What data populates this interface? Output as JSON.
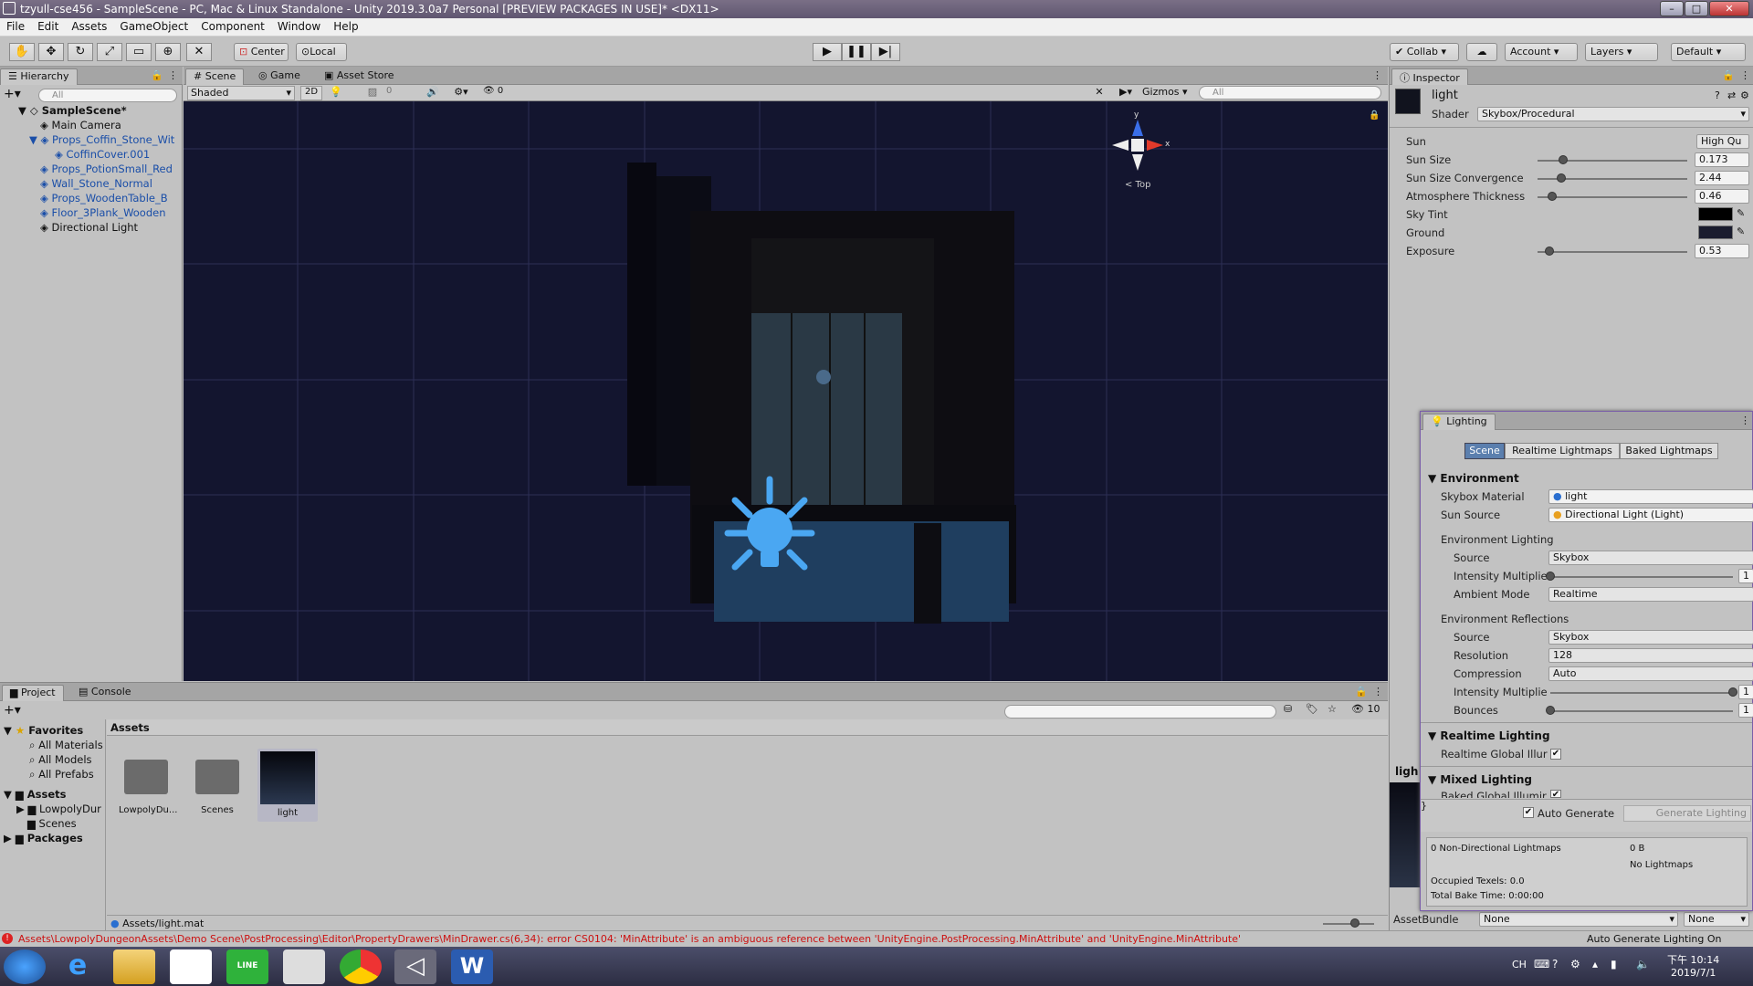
{
  "window": {
    "title": "tzyull-cse456 - SampleScene - PC, Mac & Linux Standalone - Unity 2019.3.0a7 Personal [PREVIEW PACKAGES IN USE]* <DX11>"
  },
  "menu": [
    "File",
    "Edit",
    "Assets",
    "GameObject",
    "Component",
    "Window",
    "Help"
  ],
  "toolbar": {
    "center": "Center",
    "local": "Local",
    "collab": "Collab",
    "account": "Account",
    "layers": "Layers",
    "layout": "Default"
  },
  "hierarchy": {
    "tab": "Hierarchy",
    "search_placeholder": "All",
    "items": [
      {
        "label": "SampleScene*"
      },
      {
        "label": "Main Camera"
      },
      {
        "label": "Props_Coffin_Stone_Wit"
      },
      {
        "label": "CoffinCover.001"
      },
      {
        "label": "Props_PotionSmall_Red"
      },
      {
        "label": "Wall_Stone_Normal"
      },
      {
        "label": "Props_WoodenTable_B"
      },
      {
        "label": "Floor_3Plank_Wooden"
      },
      {
        "label": "Directional Light"
      }
    ]
  },
  "scene": {
    "tabs": [
      "Scene",
      "Game",
      "Asset Store"
    ],
    "shading": "Shaded",
    "mode2d": "2D",
    "hidden_count": "0",
    "layers_count": "0",
    "gizmos": "Gizmos",
    "search_placeholder": "All",
    "gizmo": {
      "y": "y",
      "x": "x",
      "view": "< Top"
    }
  },
  "inspector": {
    "tab": "Inspector",
    "name": "light",
    "shader_label": "Shader",
    "shader": "Skybox/Procedural",
    "props": [
      {
        "label": "Sun",
        "value": "High Qu"
      },
      {
        "label": "Sun Size",
        "value": "0.173",
        "level": 0.17
      },
      {
        "label": "Sun Size Convergence",
        "value": "2.44",
        "level": 0.16
      },
      {
        "label": "Atmosphere Thickness",
        "value": "0.46",
        "level": 0.1
      },
      {
        "label": "Sky Tint",
        "color": "#000000"
      },
      {
        "label": "Ground",
        "color": "#1a1c2e"
      },
      {
        "label": "Exposure",
        "value": "0.53",
        "level": 0.08
      }
    ],
    "assetbundle_label": "AssetBundle",
    "assetbundle": "None",
    "assetbundle_variant": "None",
    "preview_label": "ligh"
  },
  "lighting": {
    "title": "Lighting",
    "tabs": [
      "Scene",
      "Realtime Lightmaps",
      "Baked Lightmaps"
    ],
    "environment": "Environment",
    "skybox_label": "Skybox Material",
    "skybox": "light",
    "sun_label": "Sun Source",
    "sun": "Directional Light (Light)",
    "env_lighting": "Environment Lighting",
    "source_label": "Source",
    "source": "Skybox",
    "intensity_label": "Intensity Multiplie",
    "intensity": "1",
    "intensity_level": 0.0,
    "ambient_label": "Ambient Mode",
    "ambient": "Realtime",
    "env_reflections": "Environment Reflections",
    "ref_source": "Skybox",
    "resolution_label": "Resolution",
    "resolution": "128",
    "compression_label": "Compression",
    "compression": "Auto",
    "ref_intensity": "1",
    "ref_intensity_level": 1.0,
    "bounces_label": "Bounces",
    "bounces": "1",
    "bounces_level": 0.0,
    "realtime": "Realtime Lighting",
    "realtime_gi": "Realtime Global Illur",
    "mixed": "Mixed Lighting",
    "baked_gi": "Baked Global Illumir",
    "auto_generate": "Auto Generate",
    "generate": "Generate Lighting",
    "stats": {
      "lightmaps": "0 Non-Directional Lightmaps",
      "size": "0 B",
      "no_lightmaps": "No Lightmaps",
      "texels": "Occupied Texels: 0.0",
      "bake_time": "Total Bake Time: 0:00:00"
    }
  },
  "project": {
    "tabs": [
      "Project",
      "Console"
    ],
    "layers_count": "10",
    "favorites": "Favorites",
    "fav_items": [
      "All Materials",
      "All Models",
      "All Prefabs"
    ],
    "assets": "Assets",
    "asset_folders": [
      "LowpolyDur",
      "Scenes"
    ],
    "packages": "Packages",
    "breadcrumb": "Assets",
    "grid": [
      {
        "label": "LowpolyDu..."
      },
      {
        "label": "Scenes"
      },
      {
        "label": "light"
      }
    ],
    "path": "Assets/light.mat"
  },
  "status": {
    "error": "Assets\\LowpolyDungeonAssets\\Demo Scene\\PostProcessing\\Editor\\PropertyDrawers\\MinDrawer.cs(6,34): error CS0104: 'MinAttribute' is an ambiguous reference between 'UnityEngine.PostProcessing.MinAttribute' and 'UnityEngine.MinAttribute'",
    "right": "Auto Generate Lighting On"
  },
  "taskbar": {
    "time": "下午 10:14",
    "date": "2019/7/1",
    "lang": "CH",
    "line": "LINE",
    "word": "W"
  }
}
